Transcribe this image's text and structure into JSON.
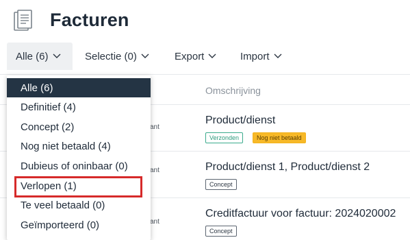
{
  "header": {
    "title": "Facturen",
    "icon": "invoice-document-icon"
  },
  "toolbar": {
    "items": [
      {
        "label": "Alle (6)",
        "icon": "chevron-down-icon"
      },
      {
        "label": "Selectie (0)",
        "icon": "chevron-down-icon"
      },
      {
        "label": "Export",
        "icon": "chevron-down-icon"
      },
      {
        "label": "Import",
        "icon": "chevron-down-icon"
      }
    ]
  },
  "table": {
    "column_header": "Omschrijving",
    "rows": [
      {
        "partial": "ant",
        "title": "Product/dienst",
        "badges": [
          "Verzonden",
          "Nog niet betaald"
        ]
      },
      {
        "partial": "ant",
        "title": "Product/dienst 1, Product/dienst 2",
        "badges": [
          "Concept"
        ]
      },
      {
        "partial": "ant",
        "title": "Creditfactuur voor factuur: 2024020002",
        "badges": [
          "Concept"
        ]
      }
    ]
  },
  "dropdown": {
    "options": [
      "Alle (6)",
      "Definitief (4)",
      "Concept (2)",
      "Nog niet betaald (4)",
      "Dubieus of oninbaar (0)",
      "Verlopen (1)",
      "Te veel betaald (0)",
      "Geïmporteerd (0)"
    ],
    "selected": "Alle (6)",
    "highlighted": "Verlopen (1)"
  },
  "colors": {
    "selected_bg": "#243444",
    "highlight_border": "#d62a2a",
    "badge_sent": "#3aaa8c",
    "badge_unpaid": "#f7b928"
  }
}
